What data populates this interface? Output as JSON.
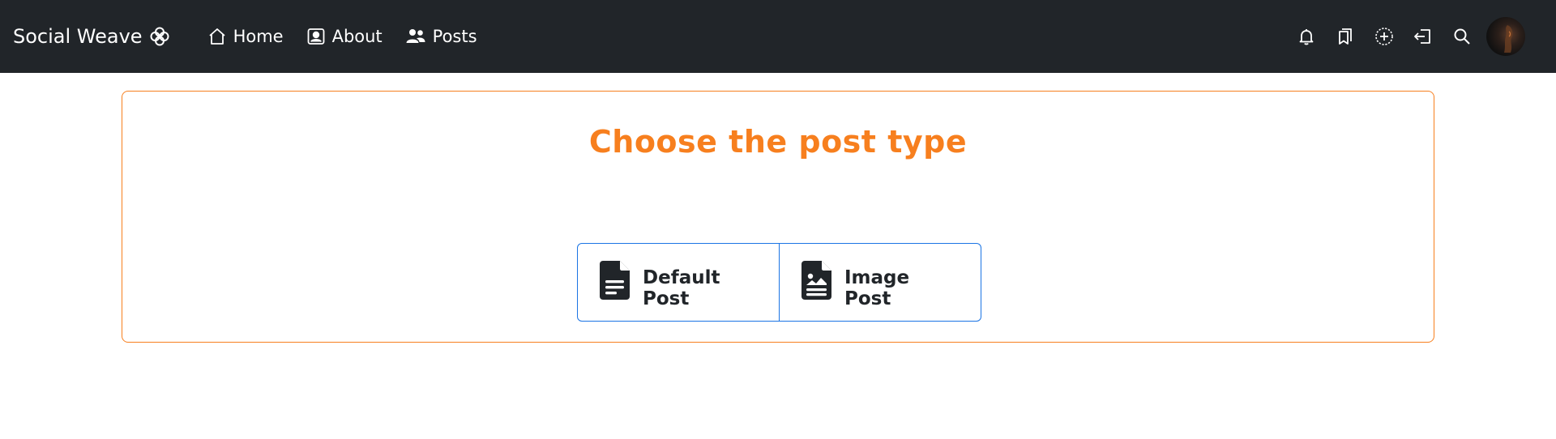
{
  "navbar": {
    "brand": "Social Weave",
    "links": [
      {
        "label": "Home",
        "icon": "home-icon"
      },
      {
        "label": "About",
        "icon": "person-badge-icon"
      },
      {
        "label": "Posts",
        "icon": "people-icon"
      }
    ],
    "right_icons": [
      "bell-icon",
      "bookmarks-icon",
      "plus-circle-icon",
      "sign-out-icon",
      "search-icon"
    ],
    "avatar": "user-avatar"
  },
  "main": {
    "title": "Choose the post type",
    "buttons": [
      {
        "label": "Default Post",
        "icon": "file-text-icon"
      },
      {
        "label": "Image Post",
        "icon": "file-image-icon"
      }
    ]
  },
  "colors": {
    "navbar_bg": "#212529",
    "accent_orange": "#f77f1e",
    "button_border_blue": "#1b74e4",
    "text_dark": "#212529"
  }
}
